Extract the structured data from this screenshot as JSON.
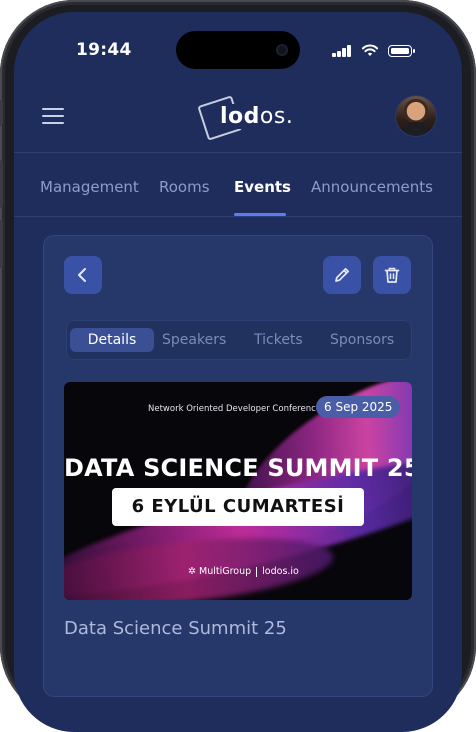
{
  "status_bar": {
    "time": "19:44"
  },
  "app": {
    "logo_text_bold": "lod",
    "logo_text_light": "os.",
    "avatar_icon": "user-avatar"
  },
  "main_tabs": [
    {
      "label": "Management",
      "active": false
    },
    {
      "label": "Rooms",
      "active": false
    },
    {
      "label": "Events",
      "active": true
    },
    {
      "label": "Announcements",
      "active": false
    }
  ],
  "card": {
    "back_icon": "chevron-left-icon",
    "edit_icon": "pencil-icon",
    "delete_icon": "trash-icon",
    "sub_tabs": [
      {
        "label": "Details",
        "active": true
      },
      {
        "label": "Speakers",
        "active": false
      },
      {
        "label": "Tickets",
        "active": false
      },
      {
        "label": "Sponsors",
        "active": false
      }
    ],
    "banner": {
      "conference_name": "Network Oriented Developer Conference",
      "date_badge": "6 Sep 2025",
      "headline": "DATA SCIENCE SUMMIT 25",
      "sub_headline": "6 EYLÜL CUMARTESİ",
      "footer_left": "MultiGroup",
      "footer_right": "lodos.io"
    },
    "event_title": "Data Science Summit 25"
  },
  "colors": {
    "screen_bg": "#1e2d5c",
    "card_bg": "#26376a",
    "accent": "#5d7cf4",
    "button_bg": "#3a52a6"
  }
}
